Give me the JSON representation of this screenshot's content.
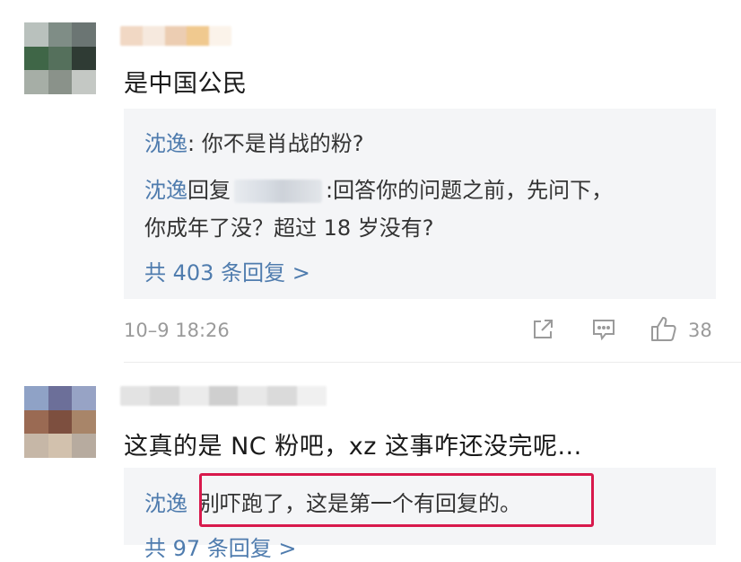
{
  "comments": [
    {
      "text": "是中国公民",
      "replies": [
        {
          "user": "沈逸",
          "text": ": 你不是肖战的粉?"
        },
        {
          "user": "沈逸",
          "verb": "回复",
          "text": ":回答你的问题之前，先问下，",
          "text2": "你成年了没？超过 18 岁没有?"
        }
      ],
      "more_replies": "共 403 条回复 >",
      "time": "10–9 18:26",
      "likes": "38"
    },
    {
      "text": "这真的是 NC 粉吧，xz 这事咋还没完呢...",
      "replies": [
        {
          "user": "沈逸",
          "text": "别吓跑了，这是第一个有回复的。"
        }
      ],
      "more_replies": "共 97 条回复 >"
    }
  ],
  "icons": [
    "share-icon",
    "comment-icon",
    "thumbs-up-icon"
  ],
  "colors": {
    "username": "#4f7cae",
    "highlight": "#d8194c",
    "reply_bg": "#f4f5f7",
    "meta": "#9a9a9a"
  }
}
